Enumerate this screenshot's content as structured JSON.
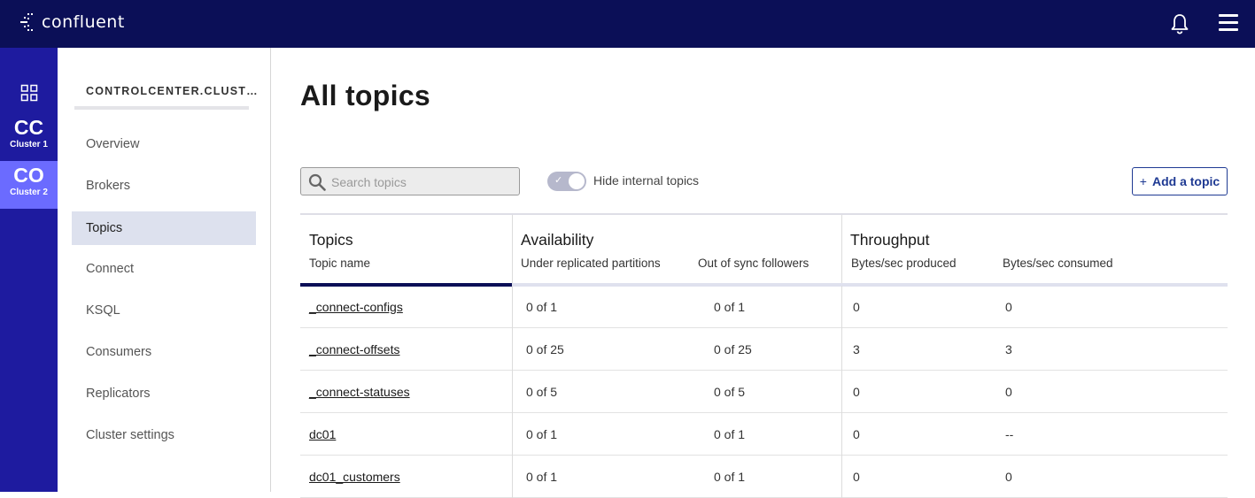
{
  "app": {
    "logo_text": "confluent"
  },
  "rail": {
    "clusters": [
      {
        "abbr": "CC",
        "name": "Cluster 1"
      },
      {
        "abbr": "CO",
        "name": "Cluster 2"
      }
    ]
  },
  "sidebar": {
    "cluster_title": "CONTROLCENTER.CLUST…",
    "items": [
      {
        "label": "Overview"
      },
      {
        "label": "Brokers"
      },
      {
        "label": "Topics"
      },
      {
        "label": "Connect"
      },
      {
        "label": "KSQL"
      },
      {
        "label": "Consumers"
      },
      {
        "label": "Replicators"
      },
      {
        "label": "Cluster settings"
      }
    ]
  },
  "main": {
    "title": "All topics",
    "search_placeholder": "Search topics",
    "toggle_label": "Hide internal topics",
    "add_button_label": "Add a topic",
    "add_button_plus": "+"
  },
  "table": {
    "groups": {
      "topics": "Topics",
      "availability": "Availability",
      "throughput": "Throughput"
    },
    "columns": {
      "topic_name": "Topic name",
      "under_replicated": "Under replicated partitions",
      "out_of_sync": "Out of sync followers",
      "produced": "Bytes/sec produced",
      "consumed": "Bytes/sec consumed"
    },
    "rows": [
      {
        "name": "_connect-configs",
        "under": "0 of 1",
        "oos": "0 of 1",
        "produced": "0",
        "consumed": "0"
      },
      {
        "name": "_connect-offsets",
        "under": "0 of 25",
        "oos": "0 of 25",
        "produced": "3",
        "consumed": "3"
      },
      {
        "name": "_connect-statuses",
        "under": "0 of 5",
        "oos": "0 of 5",
        "produced": "0",
        "consumed": "0"
      },
      {
        "name": "dc01",
        "under": "0 of 1",
        "oos": "0 of 1",
        "produced": "0",
        "consumed": "--"
      },
      {
        "name": "dc01_customers",
        "under": "0 of 1",
        "oos": "0 of 1",
        "produced": "0",
        "consumed": "0"
      }
    ]
  },
  "colors": {
    "topbar": "#0b0f57",
    "rail": "#1e1b9f",
    "active_cluster": "#6b6bff",
    "accent": "#1f3a93",
    "active_nav": "#dde1ee"
  }
}
